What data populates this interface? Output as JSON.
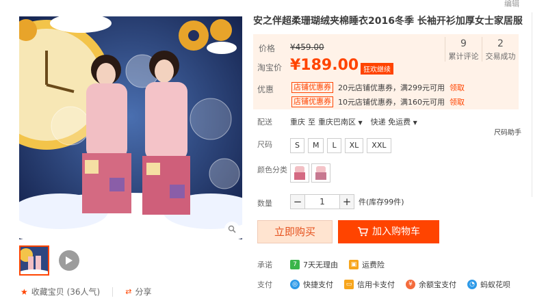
{
  "edit_link": "编辑",
  "title": "安之伴超柔珊瑚绒夹棉睡衣2016冬季 长袖开衫加厚女士家居服",
  "price": {
    "label": "价格",
    "original": "¥459.00",
    "taobao_label": "淘宝价",
    "current": "¥189.00",
    "promo_tag": "狂欢继续"
  },
  "stats": [
    {
      "num": "9",
      "label": "累计评论"
    },
    {
      "num": "2",
      "label": "交易成功"
    }
  ],
  "coupons": {
    "label": "优惠",
    "items": [
      {
        "tag": "店铺优惠券",
        "text": "20元店铺优惠券，满299元可用",
        "link": "领取"
      },
      {
        "tag": "店铺优惠券",
        "text": "10元店铺优惠券，满160元可用",
        "link": "领取"
      }
    ]
  },
  "shipping": {
    "label": "配送",
    "from": "重庆",
    "to_word": "至",
    "to": "重庆巴南区",
    "method": "快递 免运费"
  },
  "size_help": "尺码助手",
  "size": {
    "label": "尺码",
    "options": [
      "S",
      "M",
      "L",
      "XL",
      "XXL"
    ]
  },
  "color": {
    "label": "颜色分类"
  },
  "quantity": {
    "label": "数量",
    "value": "1",
    "minus": "−",
    "plus": "+",
    "stock": "件(库存99件)"
  },
  "buttons": {
    "buy": "立即购买",
    "cart": "加入购物车"
  },
  "promise": {
    "label": "承诺",
    "items": [
      "7天无理由",
      "运费险"
    ]
  },
  "payment": {
    "label": "支付",
    "items": [
      "快捷支付",
      "信用卡支付",
      "余额宝支付",
      "蚂蚁花呗"
    ]
  },
  "left_actions": {
    "favorite": "收藏宝贝 (36人气)",
    "share": "分享"
  },
  "colors": {
    "accent": "#ff4400",
    "price_bg": "#fff2e8"
  }
}
